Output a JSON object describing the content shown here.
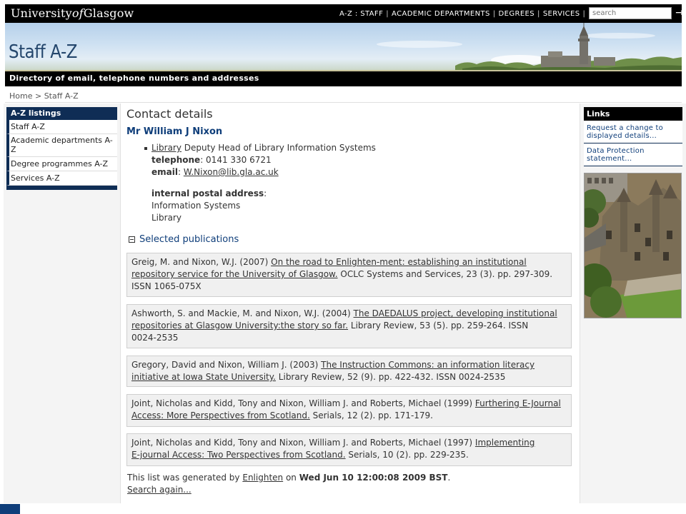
{
  "header": {
    "logo_prefix": "University",
    "logo_of": "of",
    "logo_suffix": "Glasgow",
    "nav": [
      {
        "label": "A-Z : STAFF"
      },
      {
        "label": "ACADEMIC DEPARTMENTS"
      },
      {
        "label": "DEGREES"
      },
      {
        "label": "SERVICES"
      }
    ],
    "search_placeholder": "search",
    "search_go_icon": "arrow-right-icon"
  },
  "banner": {
    "title": "Staff A-Z",
    "tagline": "Directory of email, telephone numbers and addresses"
  },
  "breadcrumb": {
    "home": "Home",
    "separator": ">",
    "current": "Staff A-Z"
  },
  "left_sidebar": {
    "heading": "A-Z listings",
    "items": [
      {
        "label": "Staff A-Z"
      },
      {
        "label": "Academic departments A-Z"
      },
      {
        "label": "Degree programmes A-Z"
      },
      {
        "label": "Services A-Z"
      }
    ]
  },
  "contact": {
    "heading": "Contact details",
    "name": "Mr William J Nixon",
    "department_link": "Library",
    "role": "Deputy Head of Library Information Systems",
    "telephone_label": "telephone",
    "telephone": "0141 330 6721",
    "email_label": "email",
    "email": "W.Nixon@lib.gla.ac.uk",
    "postal_label": "internal postal address",
    "postal_lines": [
      "Information Systems",
      "Library"
    ]
  },
  "publications": {
    "heading": "Selected publications",
    "items": [
      {
        "authors": "Greig, M. and Nixon, W.J. (2007)",
        "title_line1": "On the road to Enlighten-ment: establishing an institutional",
        "title_line2": "repository service for the University of Glasgow.",
        "rest_line2": "OCLC Systems and Services, 23 (3). pp. 297-309.",
        "line3": "ISSN 1065-075X"
      },
      {
        "authors": "Ashworth, S. and Mackie, M. and Nixon, W.J. (2004)",
        "title_line1": "The DAEDALUS project, developing institutional",
        "title_line2": "repositories at Glasgow University:the story so far.",
        "rest_line2": "Library Review, 53 (5). pp. 259-264. ISSN",
        "line3": "0024-2535"
      },
      {
        "authors": "Gregory, David and Nixon, William J. (2003)",
        "title_line1": "The Instruction Commons: an information literacy",
        "title_line2": "initiative at Iowa State University.",
        "rest_line2": "Library Review, 52 (9). pp. 422-432. ISSN 0024-2535",
        "line3": ""
      },
      {
        "authors": "Joint, Nicholas and Kidd, Tony and Nixon, William J. and Roberts, Michael (1999)",
        "title_line1": "Furthering E-Journal",
        "title_line2": "Access: More Perspectives from Scotland.",
        "rest_line2": "Serials, 12 (2). pp. 171-179.",
        "line3": ""
      },
      {
        "authors": "Joint, Nicholas and Kidd, Tony and Nixon, William J. and Roberts, Michael (1997)",
        "title_line1": "Implementing",
        "title_line2": "E-journal Access: Two Perspectives from Scotland.",
        "rest_line2": "Serials, 10 (2). pp. 229-235.",
        "line3": ""
      }
    ],
    "generated_prefix": "This list was generated by",
    "generated_link": "Enlighten",
    "generated_on": "on",
    "generated_date": "Wed Jun 10 12:00:08 2009 BST",
    "generated_suffix": ".",
    "search_again": "Search again..."
  },
  "right_sidebar": {
    "heading": "Links",
    "items": [
      {
        "line1": "Request a change to",
        "line2": "displayed details..."
      },
      {
        "line1": "Data Protection",
        "line2": "statement..."
      }
    ]
  },
  "colors": {
    "navy": "#0f2d55",
    "link_blue": "#0f3e7a",
    "black_bar": "#000000"
  }
}
